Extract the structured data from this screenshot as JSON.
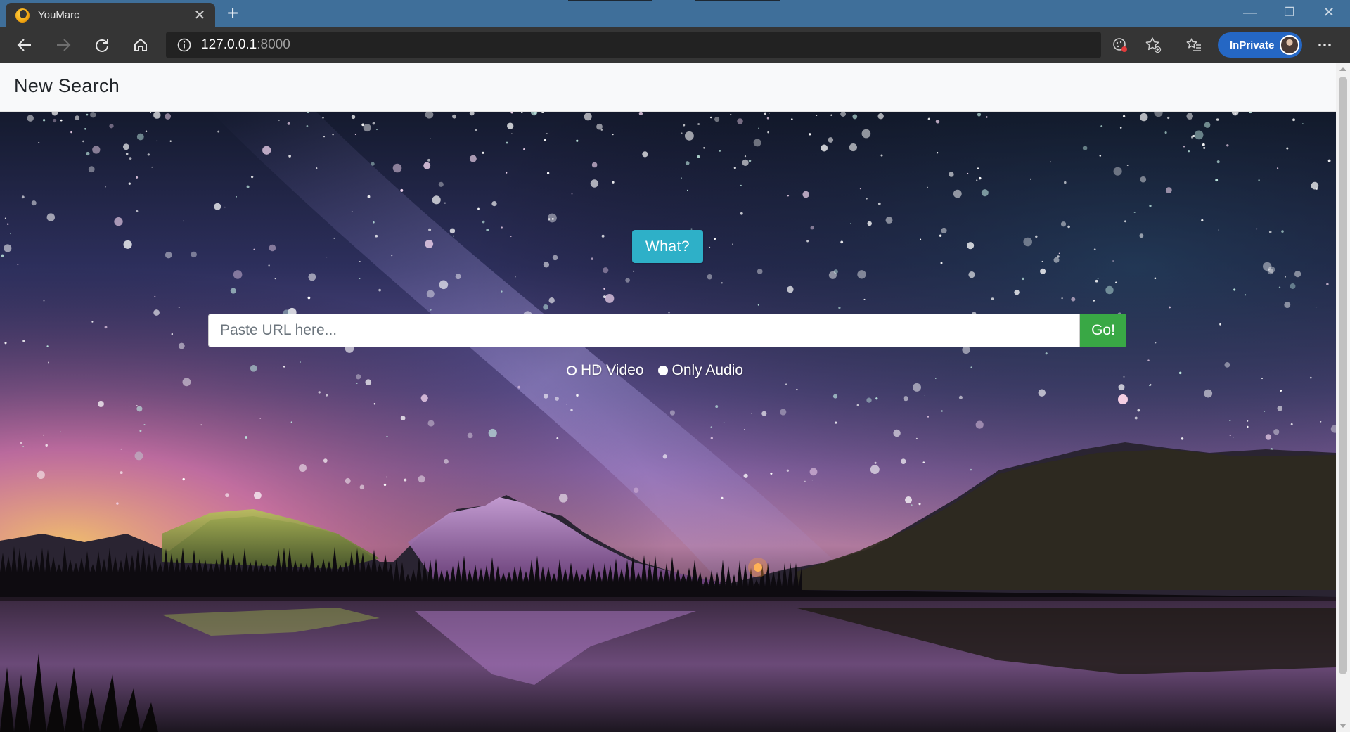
{
  "browser": {
    "tab_title": "YouMarc",
    "tab_close": "✕",
    "new_tab": "+",
    "url_host": "127.0.0.1",
    "url_port": ":8000",
    "inprivate_label": "InPrivate",
    "window_controls": {
      "minimize": "—",
      "restore": "❐",
      "close": "✕"
    },
    "icons": [
      "back-icon",
      "forward-icon",
      "refresh-icon",
      "home-icon",
      "info-icon",
      "tracking-prevention-icon",
      "add-favorite-icon",
      "favorites-icon",
      "more-icon"
    ]
  },
  "navbar": {
    "brand": "New Search"
  },
  "main": {
    "what_button": "What?",
    "url_input": {
      "placeholder": "Paste URL here...",
      "value": ""
    },
    "go_button": "Go!",
    "format_options": [
      {
        "label": "HD Video",
        "selected": false
      },
      {
        "label": "Only Audio",
        "selected": true
      }
    ]
  },
  "colors": {
    "tabbar": "#3f6f9a",
    "toolbar": "#353535",
    "inprivate": "#2567c4",
    "what_button": "#2eb0c8",
    "go_button": "#39a845",
    "navbar": "#f8f9fa"
  }
}
